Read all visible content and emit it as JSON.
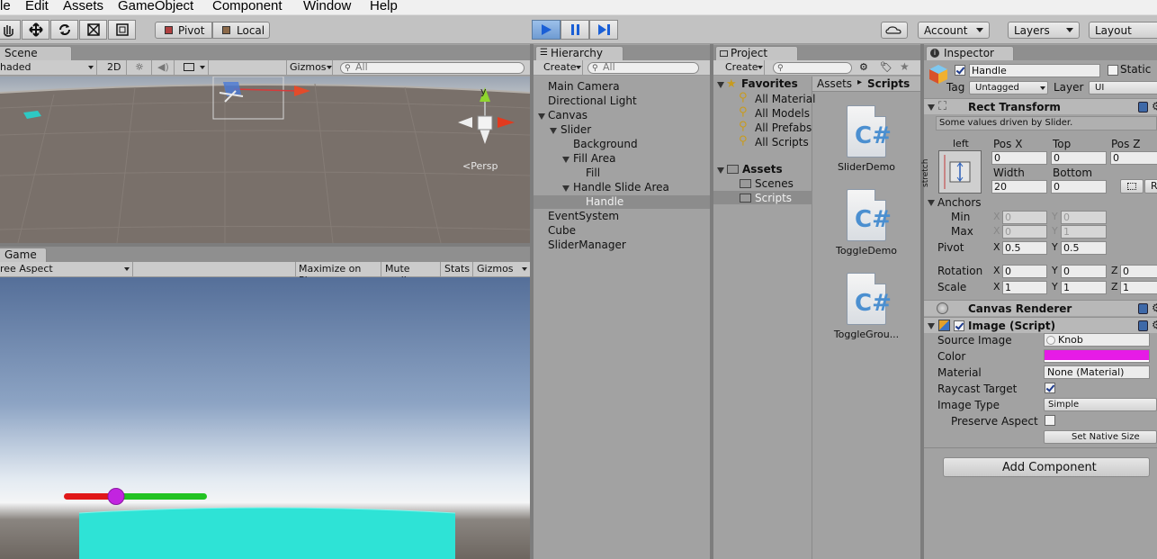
{
  "menu": [
    "le",
    "Edit",
    "Assets",
    "GameObject",
    "Component",
    "Window",
    "Help"
  ],
  "toolbar": {
    "pivot_label": "Pivot",
    "local_label": "Local",
    "account_label": "Account",
    "layers_label": "Layers",
    "layout_label": "Layout"
  },
  "scene": {
    "tab_label": "Scene",
    "shading": "haded",
    "mode_2d": "2D",
    "gizmos": "Gizmos",
    "search_placeholder": "All",
    "persp_label": "Persp",
    "axis_y": "y"
  },
  "game": {
    "tab_label": "Game",
    "aspect": "ree Aspect",
    "maximize": "Maximize on Play",
    "mute": "Mute audio",
    "stats": "Stats",
    "gizmos": "Gizmos"
  },
  "hierarchy": {
    "tab_label": "Hierarchy",
    "create": "Create",
    "search_placeholder": "All",
    "items": [
      {
        "label": "Main Camera"
      },
      {
        "label": "Directional Light"
      },
      {
        "label": "Canvas"
      },
      {
        "label": "Slider"
      },
      {
        "label": "Background"
      },
      {
        "label": "Fill Area"
      },
      {
        "label": "Fill"
      },
      {
        "label": "Handle Slide Area"
      },
      {
        "label": "Handle"
      },
      {
        "label": "EventSystem"
      },
      {
        "label": "Cube"
      },
      {
        "label": "SliderManager"
      }
    ]
  },
  "project": {
    "tab_label": "Project",
    "create": "Create",
    "favorites_label": "Favorites",
    "favorites": [
      "All Material",
      "All Models",
      "All Prefabs",
      "All Scripts"
    ],
    "assets_label": "Assets",
    "folders": [
      "Scenes",
      "Scripts"
    ],
    "breadcrumb_root": "Assets",
    "breadcrumb_sep": "▸",
    "breadcrumb_current": "Scripts",
    "files": [
      {
        "name": "SliderDemo",
        "glyph": "C#"
      },
      {
        "name": "ToggleDemo",
        "glyph": "C#"
      },
      {
        "name": "ToggleGrou...",
        "glyph": "C#"
      }
    ]
  },
  "inspector": {
    "tab_label": "Inspector",
    "object_name": "Handle",
    "static_label": "Static",
    "tag_label": "Tag",
    "tag_value": "Untagged",
    "layer_label": "Layer",
    "layer_value": "UI",
    "rect_transform": {
      "title": "Rect Transform",
      "note": "Some values driven by Slider.",
      "anchor_h": "left",
      "anchor_v": "stretch",
      "pos_x_label": "Pos X",
      "top_label": "Top",
      "pos_z_label": "Pos Z",
      "pos_x": "0",
      "top": "0",
      "pos_z": "0",
      "width_label": "Width",
      "bottom_label": "Bottom",
      "width": "20",
      "bottom": "0",
      "r_label": "R",
      "anchors_label": "Anchors",
      "min_label": "Min",
      "max_label": "Max",
      "x_label": "X",
      "y_label": "Y",
      "z_label": "Z",
      "min_x": "0",
      "min_y": "0",
      "max_x": "0",
      "max_y": "1",
      "pivot_label": "Pivot",
      "pivot_x": "0.5",
      "pivot_y": "0.5",
      "rotation_label": "Rotation",
      "rot_x": "0",
      "rot_y": "0",
      "rot_z": "0",
      "scale_label": "Scale",
      "scale_x": "1",
      "scale_y": "1",
      "scale_z": "1"
    },
    "canvas_renderer": {
      "title": "Canvas Renderer"
    },
    "image": {
      "title": "Image (Script)",
      "source_label": "Source Image",
      "source_value": "Knob",
      "color_label": "Color",
      "color_value": "#e61be6",
      "material_label": "Material",
      "material_value": "None (Material)",
      "raycast_label": "Raycast Target",
      "type_label": "Image Type",
      "type_value": "Simple",
      "preserve_label": "Preserve Aspect",
      "native_size": "Set Native Size"
    },
    "add_component": "Add Component"
  },
  "colors": {
    "panel": "#a2a2a2",
    "toolbar": "#c2c2c2",
    "play_active": "#6f9bd2",
    "slider_red": "#e01818",
    "slider_green": "#22c322",
    "slider_handle": "#c224e0",
    "cube": "#2ee3d6"
  }
}
